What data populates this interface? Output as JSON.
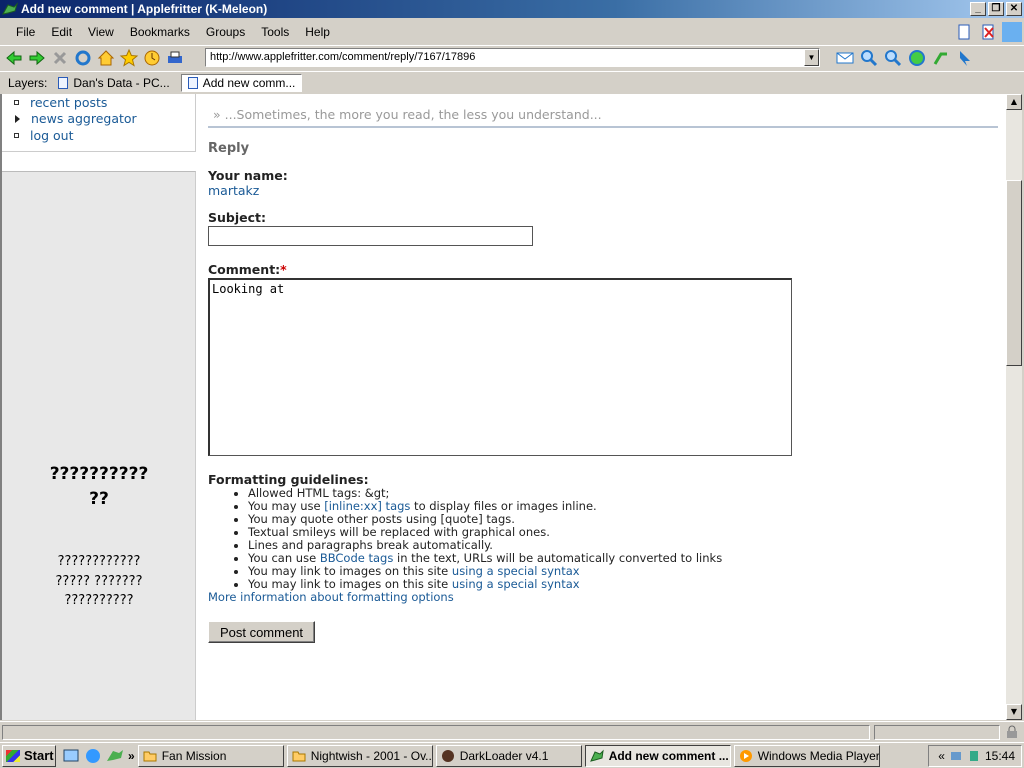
{
  "window": {
    "title": "Add new comment | Applefritter (K-Meleon)"
  },
  "menu": [
    {
      "label": "File"
    },
    {
      "label": "Edit"
    },
    {
      "label": "View"
    },
    {
      "label": "Bookmarks"
    },
    {
      "label": "Groups"
    },
    {
      "label": "Tools"
    },
    {
      "label": "Help"
    }
  ],
  "toolbar": {
    "url": "http://www.applefritter.com/comment/reply/7167/17896"
  },
  "layers": {
    "label": "Layers:",
    "tabs": [
      {
        "label": "Dan's Data - PC..."
      },
      {
        "label": "Add new comm..."
      }
    ]
  },
  "sidebar": {
    "links": [
      {
        "label": "recent posts"
      },
      {
        "label": "news aggregator"
      },
      {
        "label": "log out"
      }
    ],
    "big_text_1": "??????????",
    "big_text_2": "??",
    "small_text_1": "????????????",
    "small_text_2": "????? ???????",
    "small_text_3": "??????????"
  },
  "page": {
    "slogan": "» ...Sometimes, the more you read, the less you understand...",
    "reply_title": "Reply",
    "your_name_label": "Your name:",
    "your_name_value": "martakz",
    "subject_label": "Subject:",
    "subject_value": "",
    "comment_label": "Comment:",
    "required_mark": "*",
    "comment_value": "Looking at",
    "formatting_label": "Formatting guidelines:",
    "guidelines": [
      {
        "pre": "Allowed HTML tags: &gt;",
        "link": "",
        "post": ""
      },
      {
        "pre": "You may use ",
        "link": "[inline:xx] tags",
        "post": " to display files or images inline."
      },
      {
        "pre": "You may quote other posts using [quote] tags.",
        "link": "",
        "post": ""
      },
      {
        "pre": "Textual smileys will be replaced with graphical ones.",
        "link": "",
        "post": ""
      },
      {
        "pre": "Lines and paragraphs break automatically.",
        "link": "",
        "post": ""
      },
      {
        "pre": "You can use ",
        "link": "BBCode tags",
        "post": " in the text, URLs will be automatically converted to links"
      },
      {
        "pre": "You may link to images on this site ",
        "link": "using a special syntax",
        "post": ""
      },
      {
        "pre": "You may link to images on this site ",
        "link": "using a special syntax",
        "post": ""
      }
    ],
    "more_info": "More information about formatting options",
    "post_button": "Post comment"
  },
  "taskbar": {
    "start": "Start",
    "tasks": [
      {
        "label": "Fan Mission",
        "icon": "folder-icon"
      },
      {
        "label": "Nightwish - 2001 - Ov...",
        "icon": "folder-icon"
      },
      {
        "label": "DarkLoader v4.1",
        "icon": "darkloader-icon"
      },
      {
        "label": "Add new comment ...",
        "icon": "kmeleon-icon"
      },
      {
        "label": "Windows Media Player",
        "icon": "media-player-icon"
      }
    ],
    "clock": "15:44"
  },
  "colors": {
    "link": "#1a5a96",
    "titlebar": "#0a246a",
    "required": "#cc0000"
  }
}
